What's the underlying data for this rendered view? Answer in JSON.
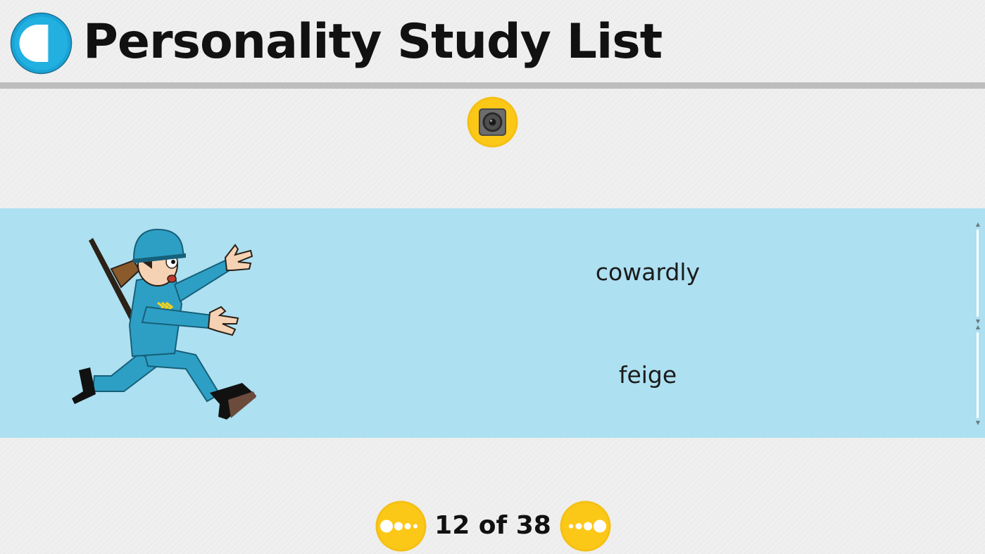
{
  "header": {
    "title": "Personality Study List",
    "back_icon": "back-arrow-icon",
    "accent": "#1aa6d9"
  },
  "audio": {
    "icon": "speaker-icon",
    "accent": "#f7c21a"
  },
  "card": {
    "background": "#ade0f1",
    "image": "running-soldier-illustration",
    "word": "cowardly",
    "translation": "feige"
  },
  "navigation": {
    "counter": "12 of 38",
    "current": 12,
    "total": 38,
    "prev_icon": "previous-dots-icon",
    "next_icon": "next-dots-icon"
  }
}
